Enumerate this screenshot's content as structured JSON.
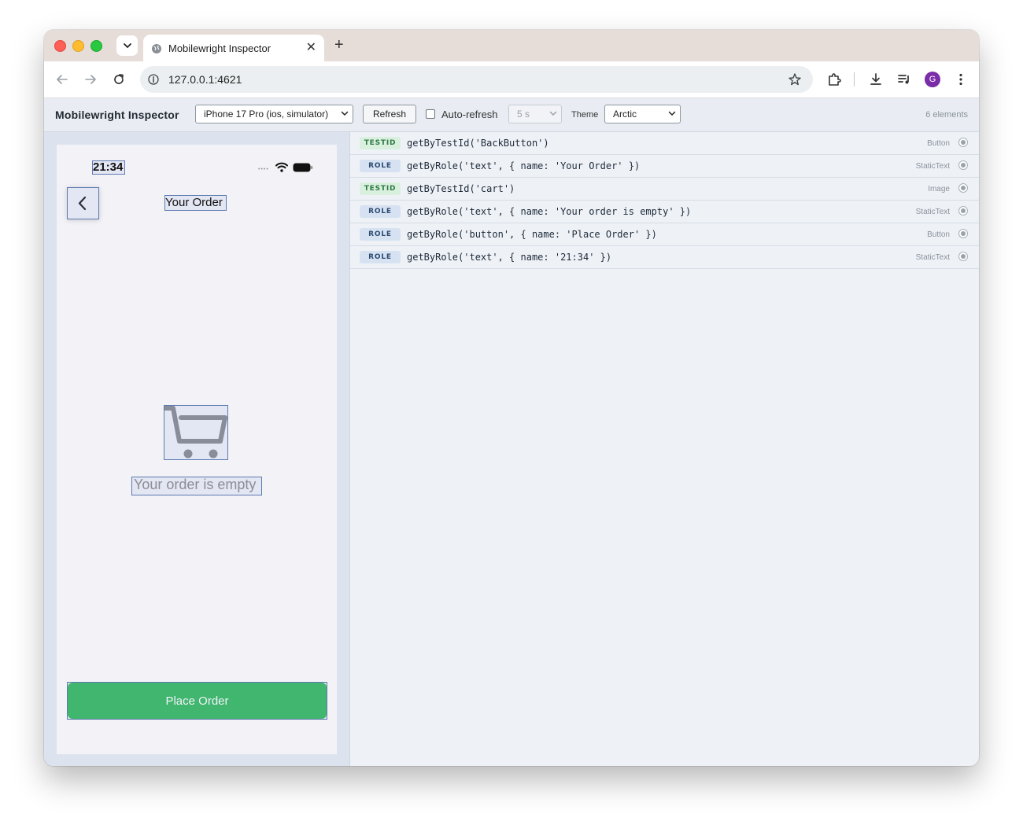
{
  "browser": {
    "tab_title": "Mobilewright Inspector",
    "url": "127.0.0.1:4621",
    "profile_initial": "G"
  },
  "header": {
    "app_title": "Mobilewright Inspector",
    "device_select": "iPhone 17 Pro (ios, simulator)",
    "refresh_label": "Refresh",
    "auto_refresh_label": "Auto-refresh",
    "auto_refresh_checked": false,
    "interval_select": "5 s",
    "theme_label": "Theme",
    "theme_select": "Arctic",
    "element_count": "6 elements"
  },
  "device": {
    "status_time": "21:34",
    "nav_title": "Your Order",
    "empty_text": "Your order is empty",
    "place_order_label": "Place Order"
  },
  "locators": [
    {
      "kind": "TESTID",
      "locator": "getByTestId('BackButton')",
      "type": "Button"
    },
    {
      "kind": "ROLE",
      "locator": "getByRole('text', { name: 'Your Order' })",
      "type": "StaticText"
    },
    {
      "kind": "TESTID",
      "locator": "getByTestId('cart')",
      "type": "Image"
    },
    {
      "kind": "ROLE",
      "locator": "getByRole('text', { name: 'Your order is empty' })",
      "type": "StaticText"
    },
    {
      "kind": "ROLE",
      "locator": "getByRole('button', { name: 'Place Order' })",
      "type": "Button"
    },
    {
      "kind": "ROLE",
      "locator": "getByRole('text', { name: '21:34' })",
      "type": "StaticText"
    }
  ],
  "colors": {
    "accent_green": "#3abb60",
    "highlight": "#5d7ab0",
    "testid_badge": "#d9f0de",
    "role_badge": "#d6e2f1"
  }
}
